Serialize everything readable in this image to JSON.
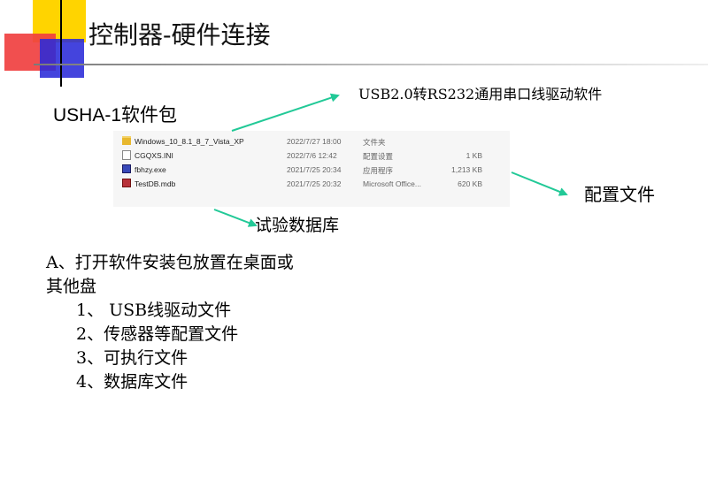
{
  "slide": {
    "title": "控制器-硬件连接",
    "usha_label": "USHA-1软件包",
    "usb_label": "USB2.0转RS232通用串口线驱动软件",
    "config_label": "配置文件",
    "db_label": "试验数据库"
  },
  "files": [
    {
      "name": "Windows_10_8.1_8_7_Vista_XP",
      "date": "2022/7/27 18:00",
      "type": "文件夹",
      "size": "",
      "icon": "folder-icon"
    },
    {
      "name": "CGQXS.INI",
      "date": "2022/7/6 12:42",
      "type": "配置设置",
      "size": "1 KB",
      "icon": "ini-file-icon"
    },
    {
      "name": "fbhzy.exe",
      "date": "2021/7/25 20:34",
      "type": "应用程序",
      "size": "1,213 KB",
      "icon": "exe-file-icon"
    },
    {
      "name": "TestDB.mdb",
      "date": "2021/7/25 20:32",
      "type": "Microsoft Office...",
      "size": "620 KB",
      "icon": "mdb-file-icon"
    }
  ],
  "instructions": {
    "line1": "A、打开软件安装包放置在桌面或",
    "line2": "其他盘",
    "items": [
      "1、 USB线驱动文件",
      "2、传感器等配置文件",
      "3、可执行文件",
      "4、数据库文件"
    ]
  },
  "colors": {
    "arrow": "#22c997",
    "yellow": "#ffd400",
    "red": "#f04040",
    "blue": "#2a2ad8"
  }
}
